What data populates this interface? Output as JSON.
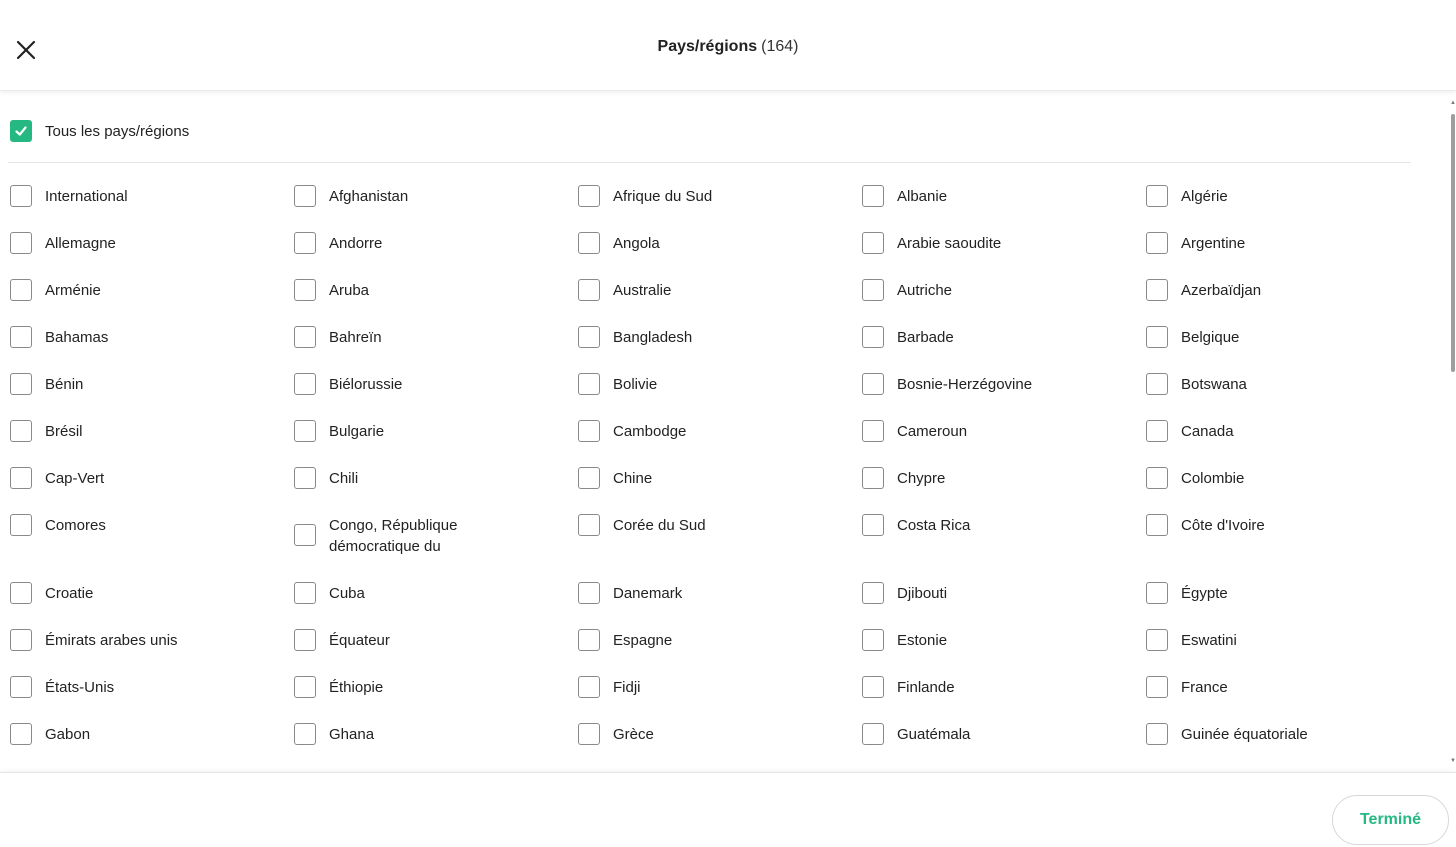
{
  "header": {
    "title": "Pays/régions",
    "count": "(164)",
    "close_icon": "close-icon"
  },
  "select_all": {
    "label": "Tous les pays/régions",
    "checked": true,
    "accent": "#26b882"
  },
  "countries": [
    [
      "International",
      "Afghanistan",
      "Afrique du Sud",
      "Albanie",
      "Algérie"
    ],
    [
      "Allemagne",
      "Andorre",
      "Angola",
      "Arabie saoudite",
      "Argentine"
    ],
    [
      "Arménie",
      "Aruba",
      "Australie",
      "Autriche",
      "Azerbaïdjan"
    ],
    [
      "Bahamas",
      "Bahreïn",
      "Bangladesh",
      "Barbade",
      "Belgique"
    ],
    [
      "Bénin",
      "Biélorussie",
      "Bolivie",
      "Bosnie-Herzégovine",
      "Botswana"
    ],
    [
      "Brésil",
      "Bulgarie",
      "Cambodge",
      "Cameroun",
      "Canada"
    ],
    [
      "Cap-Vert",
      "Chili",
      "Chine",
      "Chypre",
      "Colombie"
    ],
    [
      "Comores",
      "Congo, République démocratique du",
      "Corée du Sud",
      "Costa Rica",
      "Côte d'Ivoire"
    ],
    [
      "Croatie",
      "Cuba",
      "Danemark",
      "Djibouti",
      "Égypte"
    ],
    [
      "Émirats arabes unis",
      "Équateur",
      "Espagne",
      "Estonie",
      "Eswatini"
    ],
    [
      "États-Unis",
      "Éthiopie",
      "Fidji",
      "Finlande",
      "France"
    ],
    [
      "Gabon",
      "Ghana",
      "Grèce",
      "Guatémala",
      "Guinée équatoriale"
    ]
  ],
  "footer": {
    "done_label": "Terminé"
  }
}
